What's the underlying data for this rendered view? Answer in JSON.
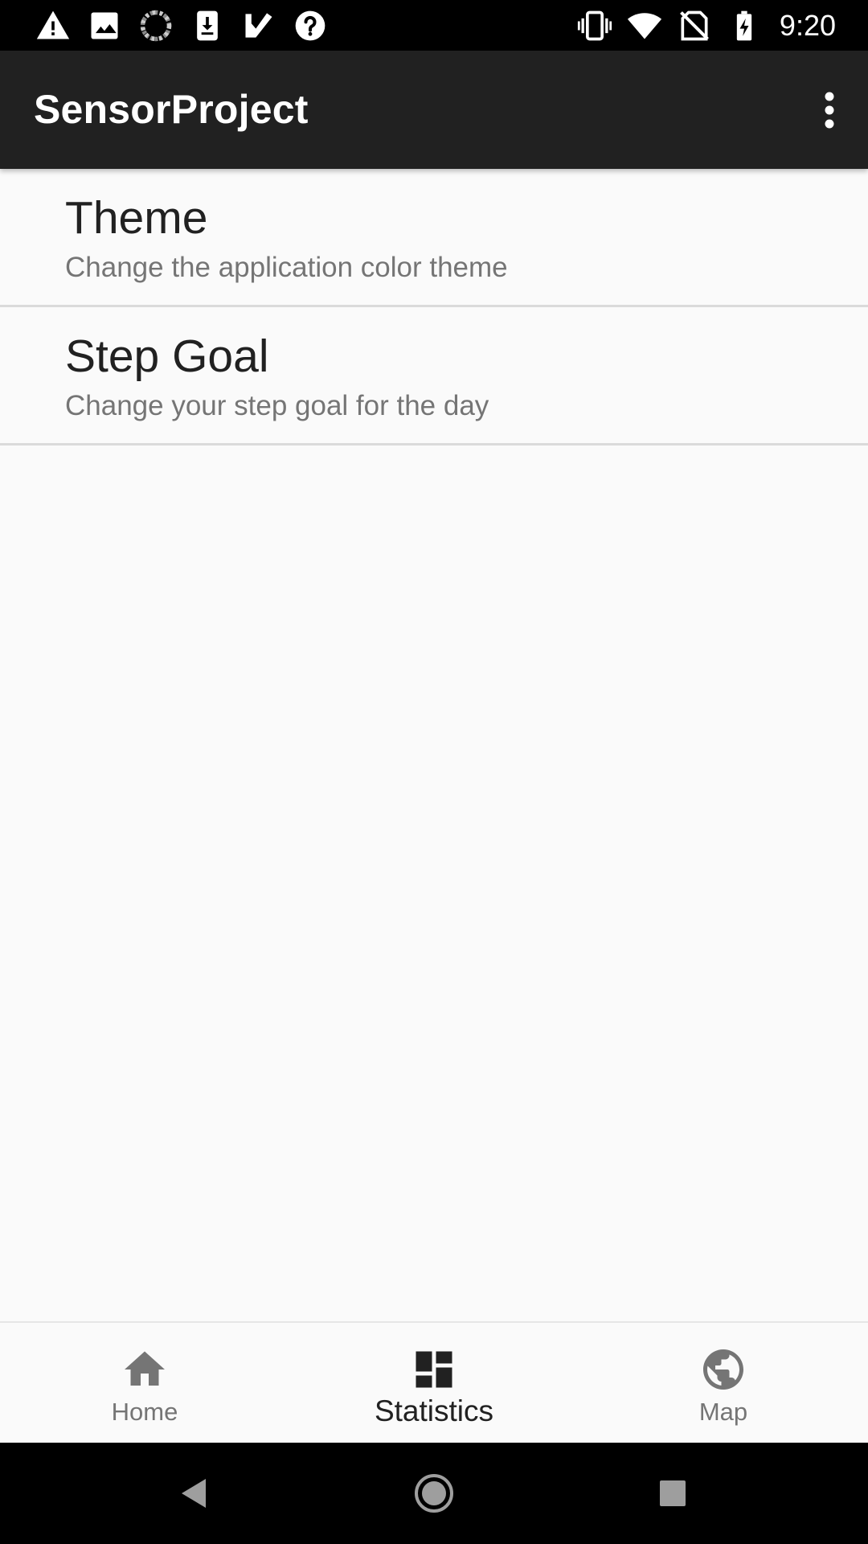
{
  "status_bar": {
    "time": "9:20",
    "left_icons": [
      "warning-icon",
      "image-icon",
      "loading-icon",
      "download-icon",
      "check-icon",
      "help-icon"
    ],
    "right_icons": [
      "vibrate-icon",
      "wifi-icon",
      "no-sim-icon",
      "battery-charging-icon"
    ]
  },
  "app_bar": {
    "title": "SensorProject",
    "overflow_icon": "more-vert-icon"
  },
  "preferences": [
    {
      "title": "Theme",
      "summary": "Change the application color theme"
    },
    {
      "title": "Step Goal",
      "summary": "Change your step goal for the day"
    }
  ],
  "bottom_nav": {
    "items": [
      {
        "label": "Home",
        "icon": "home-icon",
        "active": false
      },
      {
        "label": "Statistics",
        "icon": "dashboard-icon",
        "active": true
      },
      {
        "label": "Map",
        "icon": "globe-icon",
        "active": false
      }
    ]
  },
  "system_nav": {
    "buttons": [
      "back-icon",
      "home-circle-icon",
      "recents-icon"
    ]
  },
  "colors": {
    "status_bar": "#000000",
    "app_bar": "#212121",
    "background": "#fafafa",
    "primary_text": "#212121",
    "secondary_text": "#757575",
    "divider": "#dadada"
  }
}
